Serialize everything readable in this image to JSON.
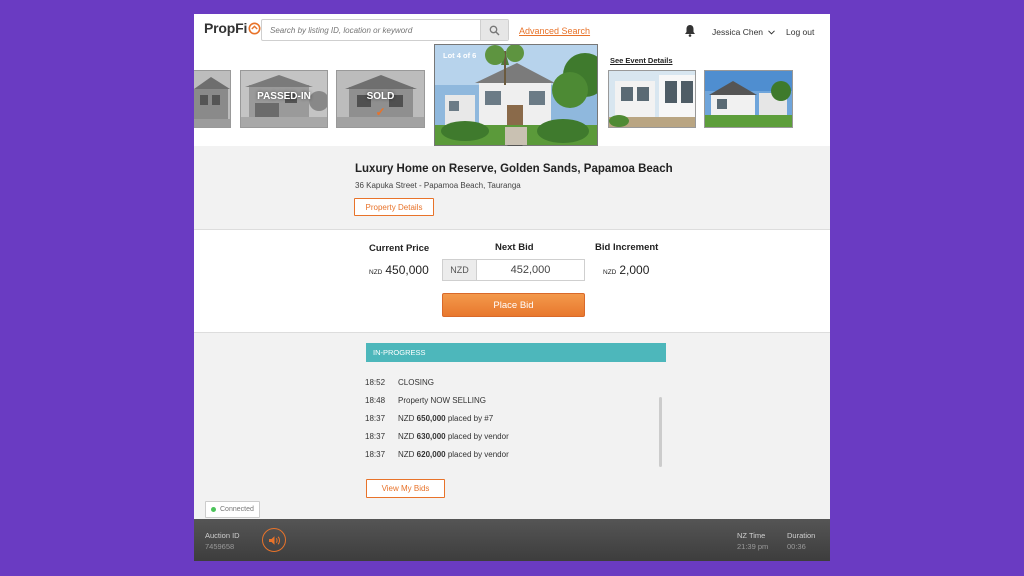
{
  "header": {
    "logo_text": "PropFi",
    "search_placeholder": "Search by listing ID, location or keyword",
    "advanced_search": "Advanced Search",
    "user_name": "Jessica Chen",
    "logout": "Log out"
  },
  "carousel": {
    "passed_in_label": "PASSED-IN",
    "sold_label": "SOLD",
    "featured_lot": "Lot 4 of 6",
    "see_event_details": "See Event Details"
  },
  "property": {
    "title": "Luxury Home on Reserve, Golden Sands, Papamoa Beach",
    "address": "36 Kapuka Street - Papamoa Beach, Tauranga",
    "details_button": "Property Details"
  },
  "bid": {
    "current_price_label": "Current Price",
    "current_price_currency": "NZD",
    "current_price_value": "450,000",
    "next_bid_label": "Next Bid",
    "next_bid_currency": "NZD",
    "next_bid_value": "452,000",
    "increment_label": "Bid Increment",
    "increment_currency": "NZD",
    "increment_value": "2,000",
    "place_bid_button": "Place Bid"
  },
  "progress": {
    "status": "IN-PROGRESS",
    "log": [
      {
        "time": "18:52",
        "pre": "CLOSING",
        "amount": "",
        "post": ""
      },
      {
        "time": "18:48",
        "pre": "Property NOW SELLING",
        "amount": "",
        "post": ""
      },
      {
        "time": "18:37",
        "pre": "NZD ",
        "amount": "650,000",
        "post": " placed by  #7"
      },
      {
        "time": "18:37",
        "pre": "NZD ",
        "amount": "630,000",
        "post": " placed by vendor"
      },
      {
        "time": "18:37",
        "pre": "NZD ",
        "amount": "620,000",
        "post": " placed by vendor"
      }
    ],
    "view_my_bids": "View My Bids",
    "connection_status": "Connected"
  },
  "footer": {
    "auction_id_label": "Auction ID",
    "auction_id_value": "7459658",
    "nz_time_label": "NZ Time",
    "nz_time_value": "21:39 pm",
    "duration_label": "Duration",
    "duration_value": "00:36"
  },
  "colors": {
    "accent": "#e8732a",
    "status_bar": "#4db7bb",
    "background": "#6a3bc2"
  }
}
